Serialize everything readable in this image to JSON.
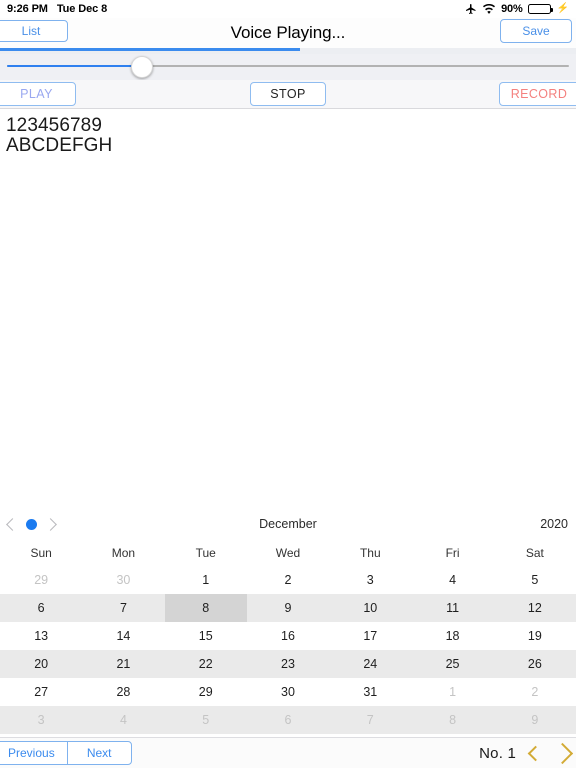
{
  "status_bar": {
    "time": "9:26 PM",
    "date": "Tue Dec 8",
    "airplane_icon": "airplane-icon",
    "wifi_icon": "wifi-icon",
    "battery_percent": "90%",
    "battery_level": 90,
    "battery_icon": "battery-icon",
    "charging_icon": "lightning-bolt-icon"
  },
  "nav_bar": {
    "left_button": "List",
    "title": "Voice Playing...",
    "right_button": "Save"
  },
  "progress": {
    "percent": 52,
    "slider_value": 24
  },
  "transport": {
    "play": "PLAY",
    "stop": "STOP",
    "record": "RECORD",
    "play_color": "#9aa8f0",
    "stop_color": "#232323",
    "record_color": "#f4817f"
  },
  "content": {
    "lines": [
      "123456789",
      "ABCDEFGH"
    ]
  },
  "calendar": {
    "prev_icon": "chevron-left-icon",
    "today_dot_icon": "today-dot-icon",
    "next_icon": "chevron-right-icon",
    "month": "December",
    "year": "2020",
    "weekdays": [
      "Sun",
      "Mon",
      "Tue",
      "Wed",
      "Thu",
      "Fri",
      "Sat"
    ],
    "selected_day": 8,
    "accent_color": "#1b7bf0",
    "weeks": [
      [
        {
          "d": "29",
          "dim": true
        },
        {
          "d": "30",
          "dim": true
        },
        {
          "d": "1",
          "dim": false
        },
        {
          "d": "2",
          "dim": false
        },
        {
          "d": "3",
          "dim": false
        },
        {
          "d": "4",
          "dim": false
        },
        {
          "d": "5",
          "dim": false
        }
      ],
      [
        {
          "d": "6",
          "dim": false
        },
        {
          "d": "7",
          "dim": false
        },
        {
          "d": "8",
          "dim": false,
          "selected": true
        },
        {
          "d": "9",
          "dim": false
        },
        {
          "d": "10",
          "dim": false
        },
        {
          "d": "11",
          "dim": false
        },
        {
          "d": "12",
          "dim": false
        }
      ],
      [
        {
          "d": "13",
          "dim": false
        },
        {
          "d": "14",
          "dim": false
        },
        {
          "d": "15",
          "dim": false
        },
        {
          "d": "16",
          "dim": false
        },
        {
          "d": "17",
          "dim": false
        },
        {
          "d": "18",
          "dim": false
        },
        {
          "d": "19",
          "dim": false
        }
      ],
      [
        {
          "d": "20",
          "dim": false
        },
        {
          "d": "21",
          "dim": false
        },
        {
          "d": "22",
          "dim": false
        },
        {
          "d": "23",
          "dim": false
        },
        {
          "d": "24",
          "dim": false
        },
        {
          "d": "25",
          "dim": false
        },
        {
          "d": "26",
          "dim": false
        }
      ],
      [
        {
          "d": "27",
          "dim": false
        },
        {
          "d": "28",
          "dim": false
        },
        {
          "d": "29",
          "dim": false
        },
        {
          "d": "30",
          "dim": false
        },
        {
          "d": "31",
          "dim": false
        },
        {
          "d": "1",
          "dim": true
        },
        {
          "d": "2",
          "dim": true
        }
      ],
      [
        {
          "d": "3",
          "dim": true
        },
        {
          "d": "4",
          "dim": true
        },
        {
          "d": "5",
          "dim": true
        },
        {
          "d": "6",
          "dim": true
        },
        {
          "d": "7",
          "dim": true
        },
        {
          "d": "8",
          "dim": true
        },
        {
          "d": "9",
          "dim": true
        }
      ]
    ]
  },
  "bottom_bar": {
    "previous": "Previous",
    "next": "Next",
    "page_label": "No. 1",
    "prev_page_icon": "chevron-left-icon",
    "next_page_icon": "chevron-right-icon",
    "chevron_color": "#d3ab36"
  }
}
